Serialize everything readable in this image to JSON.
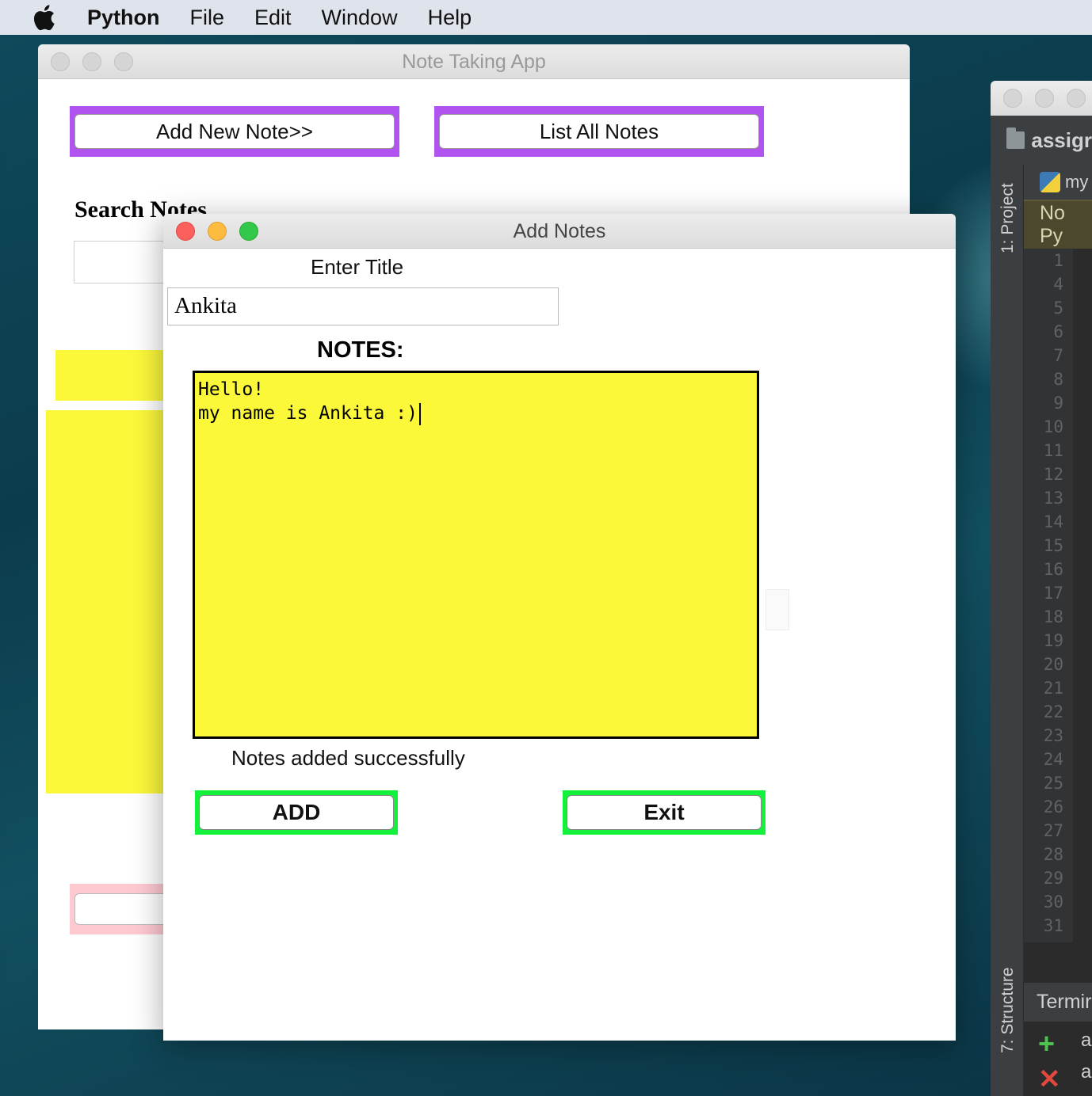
{
  "menubar": {
    "app_name": "Python",
    "items": [
      "File",
      "Edit",
      "Window",
      "Help"
    ]
  },
  "main_window": {
    "title": "Note Taking App",
    "add_new_note_label": "Add New Note>>",
    "list_all_notes_label": "List All Notes",
    "search_label": "Search Notes"
  },
  "add_window": {
    "title": "Add Notes",
    "enter_title_label": "Enter Title",
    "title_value": "Ankita",
    "notes_label": "NOTES:",
    "notes_line_1": "Hello!",
    "notes_line_2": "my name is Ankita :)",
    "status_text": "Notes added successfully",
    "add_button_label": "ADD",
    "exit_button_label": "Exit"
  },
  "ide": {
    "project_name": "assigr",
    "project_tool_label": "1: Project",
    "structure_tool_label": "7: Structure",
    "editor_tab_label": "my",
    "banner_text": "No Py",
    "line_numbers": [
      "1",
      "4",
      "5",
      "6",
      "7",
      "8",
      "9",
      "10",
      "11",
      "12",
      "13",
      "14",
      "15",
      "16",
      "17",
      "18",
      "19",
      "20",
      "21",
      "22",
      "23",
      "24",
      "25",
      "26",
      "27",
      "28",
      "29",
      "30",
      "31"
    ],
    "terminal_label": "Termir",
    "terminal_line_1": "a",
    "terminal_line_2": "a"
  },
  "colors": {
    "purple_button_border": "#b153ee",
    "green_button_border": "#13f13b",
    "note_yellow": "#fbf83a",
    "pink_button_border": "#ffc9d2"
  }
}
